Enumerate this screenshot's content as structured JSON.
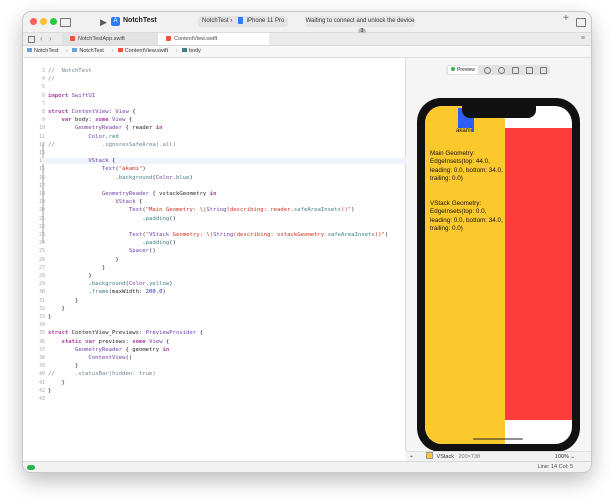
{
  "titlebar": {
    "app_name": "NotchTest",
    "scheme": "NotchTest",
    "scheme_sep": "›",
    "device": "iPhone 11 Pro",
    "status_text": "Waiting to connect and unlock the device",
    "status_badge": "3"
  },
  "tabs": [
    {
      "label": "NotchTestApp.swift"
    },
    {
      "label": "ContentView.swift"
    }
  ],
  "breadcrumb": [
    "NotchTest",
    "NotchTest",
    "ContentView.swift",
    "body"
  ],
  "editor": {
    "lines": [
      {
        "num": "3",
        "text": "//  NotchTest"
      },
      {
        "num": "4",
        "text": "//"
      },
      {
        "num": "5",
        "text": ""
      },
      {
        "num": "6",
        "text": "import SwiftUI"
      },
      {
        "num": "7",
        "text": ""
      },
      {
        "num": "8",
        "text": "struct ContentView: View {"
      },
      {
        "num": "9",
        "text": "    var body: some View {"
      },
      {
        "num": "10",
        "text": "        GeometryReader { reader in"
      },
      {
        "num": "11",
        "text": "            Color.red"
      },
      {
        "num": "12",
        "text": "//              .ignoresSafeArea(.all)"
      },
      {
        "num": "13",
        "text": ""
      },
      {
        "num": "14",
        "text": "            VStack {"
      },
      {
        "num": "15",
        "text": "                Text(\"akami\")"
      },
      {
        "num": "16",
        "text": "                    .background(Color.blue)"
      },
      {
        "num": "17",
        "text": ""
      },
      {
        "num": "18",
        "text": "                GeometryReader { vstackGeometry in"
      },
      {
        "num": "19",
        "text": "                    VStack {"
      },
      {
        "num": "20",
        "text": "                        Text(\"Main Geometry: \\(String(describing: reader.safeAreaInsets))\")"
      },
      {
        "num": "21",
        "text": "                            .padding()"
      },
      {
        "num": "22",
        "text": ""
      },
      {
        "num": "23",
        "text": "                        Text(\"VStack Geometry: \\(String(describing: vstackGeometry.safeAreaInsets))\")"
      },
      {
        "num": "24",
        "text": "                            .padding()"
      },
      {
        "num": "25",
        "text": "                        Spacer()"
      },
      {
        "num": "26",
        "text": "                    }"
      },
      {
        "num": "27",
        "text": "                }"
      },
      {
        "num": "28",
        "text": "            }"
      },
      {
        "num": "29",
        "text": "            .background(Color.yellow)"
      },
      {
        "num": "30",
        "text": "            .frame(maxWidth: 200.0)"
      },
      {
        "num": "31",
        "text": "        }"
      },
      {
        "num": "32",
        "text": "    }"
      },
      {
        "num": "33",
        "text": "}"
      },
      {
        "num": "34",
        "text": ""
      },
      {
        "num": "35",
        "text": "struct ContentView_Previews: PreviewProvider {"
      },
      {
        "num": "36",
        "text": "    static var previews: some View {"
      },
      {
        "num": "37",
        "text": "        GeometryReader { geometry in"
      },
      {
        "num": "38",
        "text": "            ContentView()"
      },
      {
        "num": "39",
        "text": "        }"
      },
      {
        "num": "40",
        "text": "//      .statusBar(hidden: true)"
      },
      {
        "num": "41",
        "text": "    }"
      },
      {
        "num": "42",
        "text": "}"
      },
      {
        "num": "43",
        "text": ""
      }
    ]
  },
  "preview": {
    "button_label": "Preview",
    "akami": "akami",
    "main_geometry": "Main Geometry: EdgeInsets(top: 44.0, leading: 0.0, bottom: 34.0, trailing: 0.0)",
    "vstack_geometry": "VStack Geometry: EdgeInsets(top: 0.0, leading: 0.0, bottom: 34.0, trailing: 0.0)"
  },
  "canvas_footer": {
    "selection": "VStack",
    "size": "200×738",
    "zoom": "100%"
  },
  "statusbar": {
    "cursor": "Line: 14  Col: 5"
  },
  "colors": {
    "yellow": "#fbc92c",
    "red": "#fc3d39",
    "blue": "#2f5cf5"
  }
}
